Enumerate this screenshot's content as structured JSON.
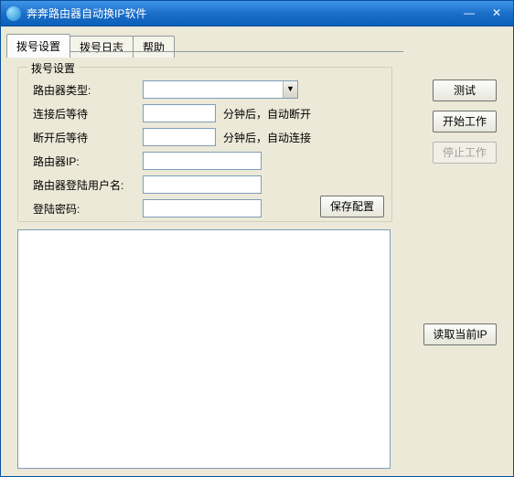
{
  "window": {
    "title": "奔奔路由器自动换IP软件"
  },
  "tabs": {
    "t0": "拨号设置",
    "t1": "拨号日志",
    "t2": "帮助"
  },
  "group": {
    "title": "拨号设置",
    "router_type_label": "路由器类型:",
    "router_type_value": "",
    "connect_wait_label": "连接后等待",
    "connect_wait_value": "",
    "connect_wait_suffix": "分钟后，自动断开",
    "disconnect_wait_label": "断开后等待",
    "disconnect_wait_value": "",
    "disconnect_wait_suffix": "分钟后，自动连接",
    "router_ip_label": "路由器IP:",
    "router_ip_value": "",
    "router_user_label": "路由器登陆用户名:",
    "router_user_value": "",
    "router_pass_label": "登陆密码:",
    "router_pass_value": ""
  },
  "buttons": {
    "test": "测试",
    "start": "开始工作",
    "stop": "停止工作",
    "save": "保存配置",
    "read_ip": "读取当前IP"
  },
  "log": ""
}
